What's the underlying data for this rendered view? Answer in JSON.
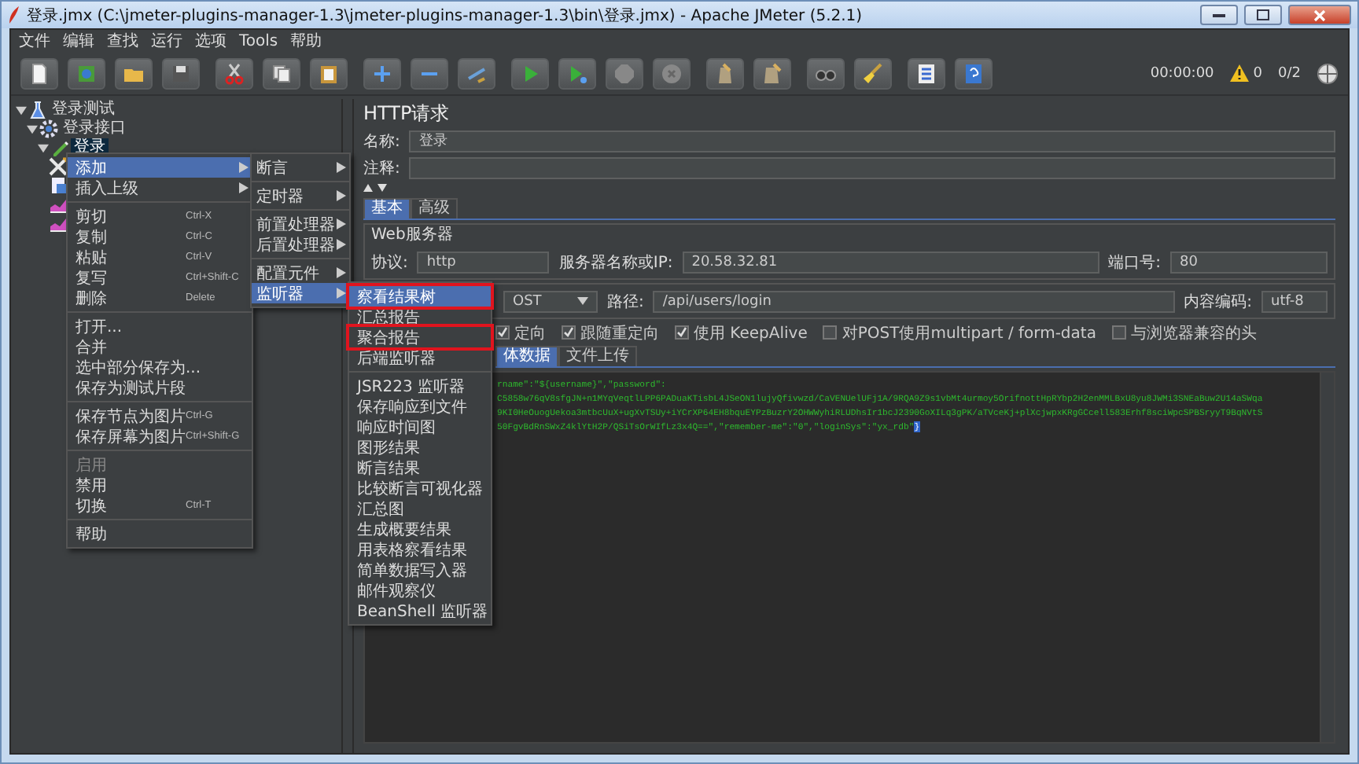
{
  "window": {
    "title": "登录.jmx (C:\\jmeter-plugins-manager-1.3\\jmeter-plugins-manager-1.3\\bin\\登录.jmx) - Apache JMeter (5.2.1)"
  },
  "menu_bar": [
    "文件",
    "编辑",
    "查找",
    "运行",
    "选项",
    "Tools",
    "帮助"
  ],
  "status": {
    "elapsed": "00:00:00",
    "warnings": "0",
    "threads": "0/2"
  },
  "tree": [
    {
      "label": "登录测试",
      "kind": "plan",
      "expanded": true,
      "selected": false,
      "children": [
        {
          "label": "登录接口",
          "kind": "thread_group",
          "expanded": true,
          "selected": false,
          "children": [
            {
              "label": "登录",
              "kind": "sampler",
              "expanded": true,
              "selected": true,
              "children": [
                {
                  "kind": "preprocessor"
                },
                {
                  "kind": "config"
                },
                {
                  "kind": "listener"
                },
                {
                  "kind": "listener"
                }
              ]
            }
          ]
        }
      ]
    }
  ],
  "context_menu": [
    {
      "kind": "item",
      "label": "添加",
      "submenu": true,
      "selected": true,
      "disabled": false
    },
    {
      "kind": "item",
      "label": "插入上级",
      "submenu": true,
      "selected": false,
      "disabled": false
    },
    {
      "kind": "separator"
    },
    {
      "kind": "item",
      "label": "剪切",
      "shortcut": "Ctrl-X",
      "submenu": false,
      "selected": false,
      "disabled": false
    },
    {
      "kind": "item",
      "label": "复制",
      "shortcut": "Ctrl-C",
      "submenu": false,
      "selected": false,
      "disabled": false
    },
    {
      "kind": "item",
      "label": "粘贴",
      "shortcut": "Ctrl-V",
      "submenu": false,
      "selected": false,
      "disabled": false
    },
    {
      "kind": "item",
      "label": "复写",
      "shortcut": "Ctrl+Shift-C",
      "submenu": false,
      "selected": false,
      "disabled": false
    },
    {
      "kind": "item",
      "label": "删除",
      "shortcut": "Delete",
      "submenu": false,
      "selected": false,
      "disabled": false
    },
    {
      "kind": "separator"
    },
    {
      "kind": "item",
      "label": "打开...",
      "submenu": false,
      "selected": false,
      "disabled": false
    },
    {
      "kind": "item",
      "label": "合并",
      "submenu": false,
      "selected": false,
      "disabled": false
    },
    {
      "kind": "item",
      "label": "选中部分保存为...",
      "submenu": false,
      "selected": false,
      "disabled": false
    },
    {
      "kind": "item",
      "label": "保存为测试片段",
      "submenu": false,
      "selected": false,
      "disabled": false
    },
    {
      "kind": "separator"
    },
    {
      "kind": "item",
      "label": "保存节点为图片",
      "shortcut": "Ctrl-G",
      "submenu": false,
      "selected": false,
      "disabled": false
    },
    {
      "kind": "item",
      "label": "保存屏幕为图片",
      "shortcut": "Ctrl+Shift-G",
      "submenu": false,
      "selected": false,
      "disabled": false
    },
    {
      "kind": "separator"
    },
    {
      "kind": "item",
      "label": "启用",
      "submenu": false,
      "selected": false,
      "disabled": true
    },
    {
      "kind": "item",
      "label": "禁用",
      "submenu": false,
      "selected": false,
      "disabled": false
    },
    {
      "kind": "item",
      "label": "切换",
      "shortcut": "Ctrl-T",
      "submenu": false,
      "selected": false,
      "disabled": false
    },
    {
      "kind": "separator"
    },
    {
      "kind": "item",
      "label": "帮助",
      "submenu": false,
      "selected": false,
      "disabled": false
    }
  ],
  "add_submenu": [
    {
      "kind": "item",
      "label": "断言",
      "selected": false
    },
    {
      "kind": "separator"
    },
    {
      "kind": "item",
      "label": "定时器",
      "selected": false
    },
    {
      "kind": "separator"
    },
    {
      "kind": "item",
      "label": "前置处理器",
      "selected": false
    },
    {
      "kind": "item",
      "label": "后置处理器",
      "selected": false
    },
    {
      "kind": "separator"
    },
    {
      "kind": "item",
      "label": "配置元件",
      "selected": false
    },
    {
      "kind": "item",
      "label": "监听器",
      "selected": true
    }
  ],
  "listener_submenu": [
    {
      "kind": "item",
      "label": "察看结果树",
      "selected": true,
      "highlighted": true
    },
    {
      "kind": "item",
      "label": "汇总报告",
      "selected": false,
      "highlighted": false
    },
    {
      "kind": "item",
      "label": "聚合报告",
      "selected": false,
      "highlighted": true
    },
    {
      "kind": "item",
      "label": "后端监听器",
      "selected": false,
      "highlighted": false
    },
    {
      "kind": "separator"
    },
    {
      "kind": "item",
      "label": "JSR223 监听器",
      "selected": false,
      "highlighted": false
    },
    {
      "kind": "item",
      "label": "保存响应到文件",
      "selected": false,
      "highlighted": false
    },
    {
      "kind": "item",
      "label": "响应时间图",
      "selected": false,
      "highlighted": false
    },
    {
      "kind": "item",
      "label": "图形结果",
      "selected": false,
      "highlighted": false
    },
    {
      "kind": "item",
      "label": "断言结果",
      "selected": false,
      "highlighted": false
    },
    {
      "kind": "item",
      "label": "比较断言可视化器",
      "selected": false,
      "highlighted": false
    },
    {
      "kind": "item",
      "label": "汇总图",
      "selected": false,
      "highlighted": false
    },
    {
      "kind": "item",
      "label": "生成概要结果",
      "selected": false,
      "highlighted": false
    },
    {
      "kind": "item",
      "label": "用表格察看结果",
      "selected": false,
      "highlighted": false
    },
    {
      "kind": "item",
      "label": "简单数据写入器",
      "selected": false,
      "highlighted": false
    },
    {
      "kind": "item",
      "label": "邮件观察仪",
      "selected": false,
      "highlighted": false
    },
    {
      "kind": "item",
      "label": "BeanShell 监听器",
      "selected": false,
      "highlighted": false
    }
  ],
  "http_request": {
    "title": "HTTP请求",
    "name_label": "名称:",
    "name": "登录",
    "comment_label": "注释:",
    "tabs": [
      {
        "label": "基本",
        "selected": true
      },
      {
        "label": "高级",
        "selected": false
      }
    ],
    "web_server": {
      "title": "Web服务器",
      "protocol_label": "协议:",
      "protocol": "http",
      "server_label": "服务器名称或IP:",
      "server": "20.58.32.81",
      "port_label": "端口号:",
      "port": "80"
    },
    "request": {
      "method": "OST",
      "path_label": "路径:",
      "path": "/api/users/login",
      "encoding_label": "内容编码:",
      "encoding": "utf-8"
    },
    "options": [
      {
        "label": "定向",
        "checked": true
      },
      {
        "label": "跟随重定向",
        "checked": true
      },
      {
        "label": "使用 KeepAlive",
        "checked": true
      },
      {
        "label": "对POST使用multipart / form-data",
        "checked": false
      },
      {
        "label": "与浏览器兼容的头",
        "checked": false
      }
    ],
    "body_tabs": [
      {
        "label": "体数据",
        "selected": true
      },
      {
        "label": "文件上传",
        "selected": false
      }
    ],
    "body_lines": [
      "rname\":\"${username}\",\"password\":",
      "C5858w76qV8sfgJN+n1MYqVeqtlLPP6PADuaKTisbL4JSeON1lujyQfivwzd/CaVENUelUFj1A/9RQA9Z9s1vbMt4urmoy5OrifnottHpRYbp2H2enMMLBxU8yu8JWMi3SNEaBuw2U14aSWqa",
      "9KI0HeOuogUekoa3mtbcUuX+ugXvTSUy+iYCrXP64EH8bquEYPzBuzrY2OHWWyhiRLUDhsIr1bcJ2390GoXILq3gPK/aTVceKj+plXcjwpxKRgGCcell583Erhf8sciWpcSPBSryyT9BqNVtS",
      "50FgvBdRnSWxZ4klYtH2P/QSiTsOrWIfLz3x4Q==\",\"remember-me\":\"0\",\"loginSys\":\"yx_rdb\""
    ],
    "cursor_char": "}"
  }
}
